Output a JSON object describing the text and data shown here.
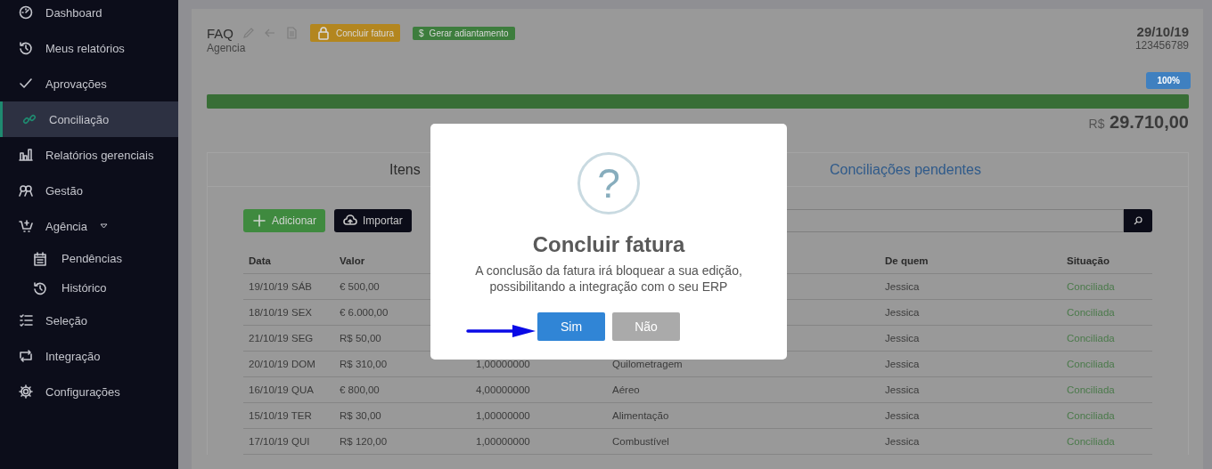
{
  "sidebar": {
    "items": [
      {
        "label": "Dashboard",
        "kind": "gauge",
        "selected": false
      },
      {
        "label": "Meus relatórios",
        "kind": "history",
        "selected": false
      },
      {
        "label": "Aprovações",
        "kind": "check",
        "selected": false
      },
      {
        "label": "Conciliação",
        "kind": "link",
        "selected": true
      },
      {
        "label": "Relatórios gerenciais",
        "kind": "bars",
        "selected": false
      },
      {
        "label": "Gestão",
        "kind": "people",
        "selected": false
      },
      {
        "label": "Agência",
        "kind": "cart",
        "selected": false,
        "expanded": true,
        "children": [
          {
            "label": "Pendências",
            "kind": "calendar",
            "selected": false
          },
          {
            "label": "Histórico",
            "kind": "history",
            "selected": false
          }
        ]
      },
      {
        "label": "Seleção",
        "kind": "list",
        "selected": false
      },
      {
        "label": "Integração",
        "kind": "loop",
        "selected": false
      },
      {
        "label": "Configurações",
        "kind": "gear",
        "selected": false
      }
    ]
  },
  "header": {
    "title": "FAQ",
    "subtitle": "Agencia",
    "badges": [
      {
        "label": "Concluir fatura",
        "kind": "lock",
        "color": "#b3861f"
      },
      {
        "label": "Gerar adiantamento",
        "kind": "symbol",
        "symbol": "$",
        "color": "#3d7d3d"
      }
    ],
    "date": "29/10/19",
    "number": "123456789"
  },
  "progress": {
    "level": 1,
    "badge": "100%"
  },
  "total": {
    "currency": "R$",
    "amount": "29.710,00"
  },
  "tabs": [
    {
      "label": "Itens",
      "selected": false
    },
    {
      "label": "Conciliações pendentes",
      "selected": true
    }
  ],
  "toolbar": {
    "buttons": [
      {
        "label": "Adicionar",
        "kind": "add"
      },
      {
        "label": "Importar",
        "kind": "import"
      }
    ]
  },
  "table": {
    "columns": [
      "Data",
      "Valor",
      null,
      null,
      "De quem",
      "Situação"
    ],
    "rows": [
      {
        "data": "19/10/19 SÁB",
        "valor": "€ 500,00",
        "de_quem": "Jessica",
        "situacao": "Conciliada"
      },
      {
        "data": "18/10/19 SEX",
        "valor": "€ 6.000,00",
        "de_quem": "Jessica",
        "situacao": "Conciliada"
      },
      {
        "data": "21/10/19 SEG",
        "valor": "R$ 50,00",
        "de_quem": "Jessica",
        "situacao": "Conciliada"
      },
      {
        "data": "20/10/19 DOM",
        "valor": "R$ 310,00",
        "column_3": "1,00000000",
        "column_4": "Quilometragem",
        "de_quem": "Jessica",
        "situacao": "Conciliada"
      },
      {
        "data": "16/10/19 QUA",
        "valor": "€ 800,00",
        "column_3": "4,00000000",
        "column_4": "Aéreo",
        "de_quem": "Jessica",
        "situacao": "Conciliada"
      },
      {
        "data": "15/10/19 TER",
        "valor": "R$ 30,00",
        "column_3": "1,00000000",
        "column_4": "Alimentação",
        "de_quem": "Jessica",
        "situacao": "Conciliada"
      },
      {
        "data": "17/10/19 QUI",
        "valor": "R$ 120,00",
        "column_3": "1,00000000",
        "column_4": "Combustível",
        "de_quem": "Jessica",
        "situacao": "Conciliada"
      }
    ]
  },
  "dialog": {
    "title": "Concluir fatura",
    "icon": "?",
    "message": "A conclusão da fatura irá bloquear a sua edição, possibilitando a integração com o seu ERP",
    "buttons": [
      {
        "label": "Sim",
        "kind": "confirm"
      },
      {
        "label": "Não",
        "kind": "cancel"
      }
    ]
  }
}
